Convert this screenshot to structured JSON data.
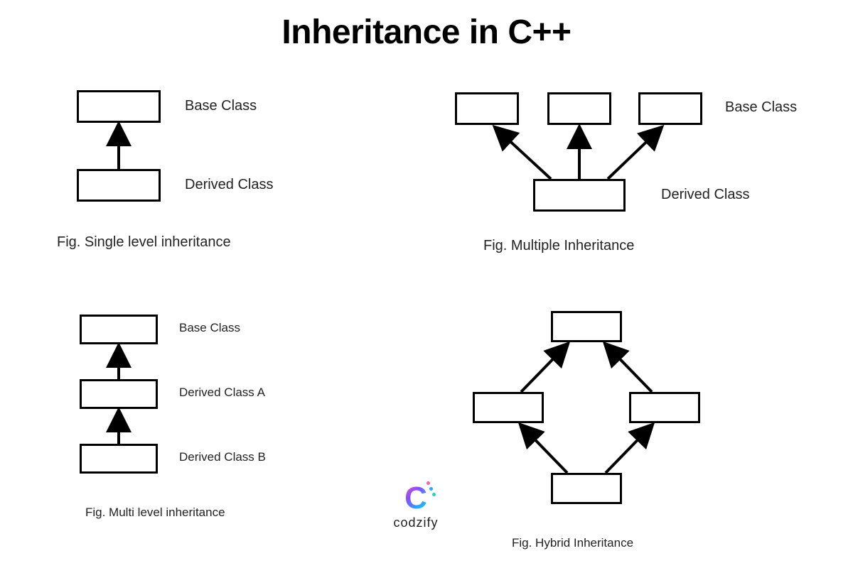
{
  "title": "Inheritance in C++",
  "brand": {
    "name": "codzify"
  },
  "diagrams": {
    "single": {
      "caption": "Fig. Single level inheritance",
      "base_label": "Base Class",
      "derived_label": "Derived Class"
    },
    "multiple": {
      "caption": "Fig. Multiple Inheritance",
      "base_label": "Base Class",
      "derived_label": "Derived Class"
    },
    "multilevel": {
      "caption": "Fig. Multi level inheritance",
      "base_label": "Base Class",
      "derived_a_label": "Derived Class A",
      "derived_b_label": "Derived Class B"
    },
    "hybrid": {
      "caption": "Fig. Hybrid Inheritance"
    }
  }
}
